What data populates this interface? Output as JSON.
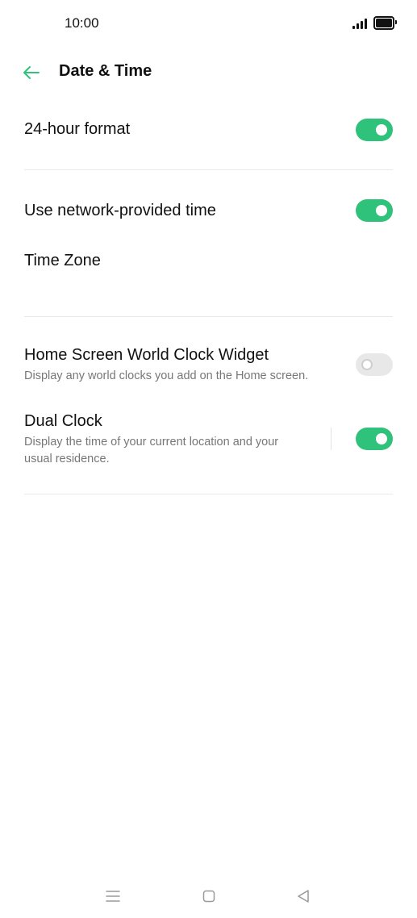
{
  "status_bar": {
    "time": "10:00"
  },
  "app_bar": {
    "title": "Date & Time",
    "back_icon": "arrow-left-icon"
  },
  "settings": {
    "hour_format": {
      "title": "24-hour format",
      "enabled": true
    },
    "network_time": {
      "title": "Use network-provided time",
      "enabled": true
    },
    "time_zone": {
      "title": "Time Zone"
    },
    "world_clock_widget": {
      "title": "Home Screen World Clock Widget",
      "subtitle": "Display any world clocks you add on the Home screen.",
      "enabled": false
    },
    "dual_clock": {
      "title": "Dual Clock",
      "subtitle_line1": "Display the time of your current location and your",
      "subtitle_line2": "usual residence.",
      "enabled": true
    }
  },
  "colors": {
    "accent": "#2fc27a",
    "toggle_off": "#e8e8e8",
    "subtitle": "#777777",
    "divider": "#e9e9e9"
  },
  "nav_bar": {
    "icons": [
      "menu-icon",
      "home-square-icon",
      "back-triangle-icon"
    ]
  }
}
